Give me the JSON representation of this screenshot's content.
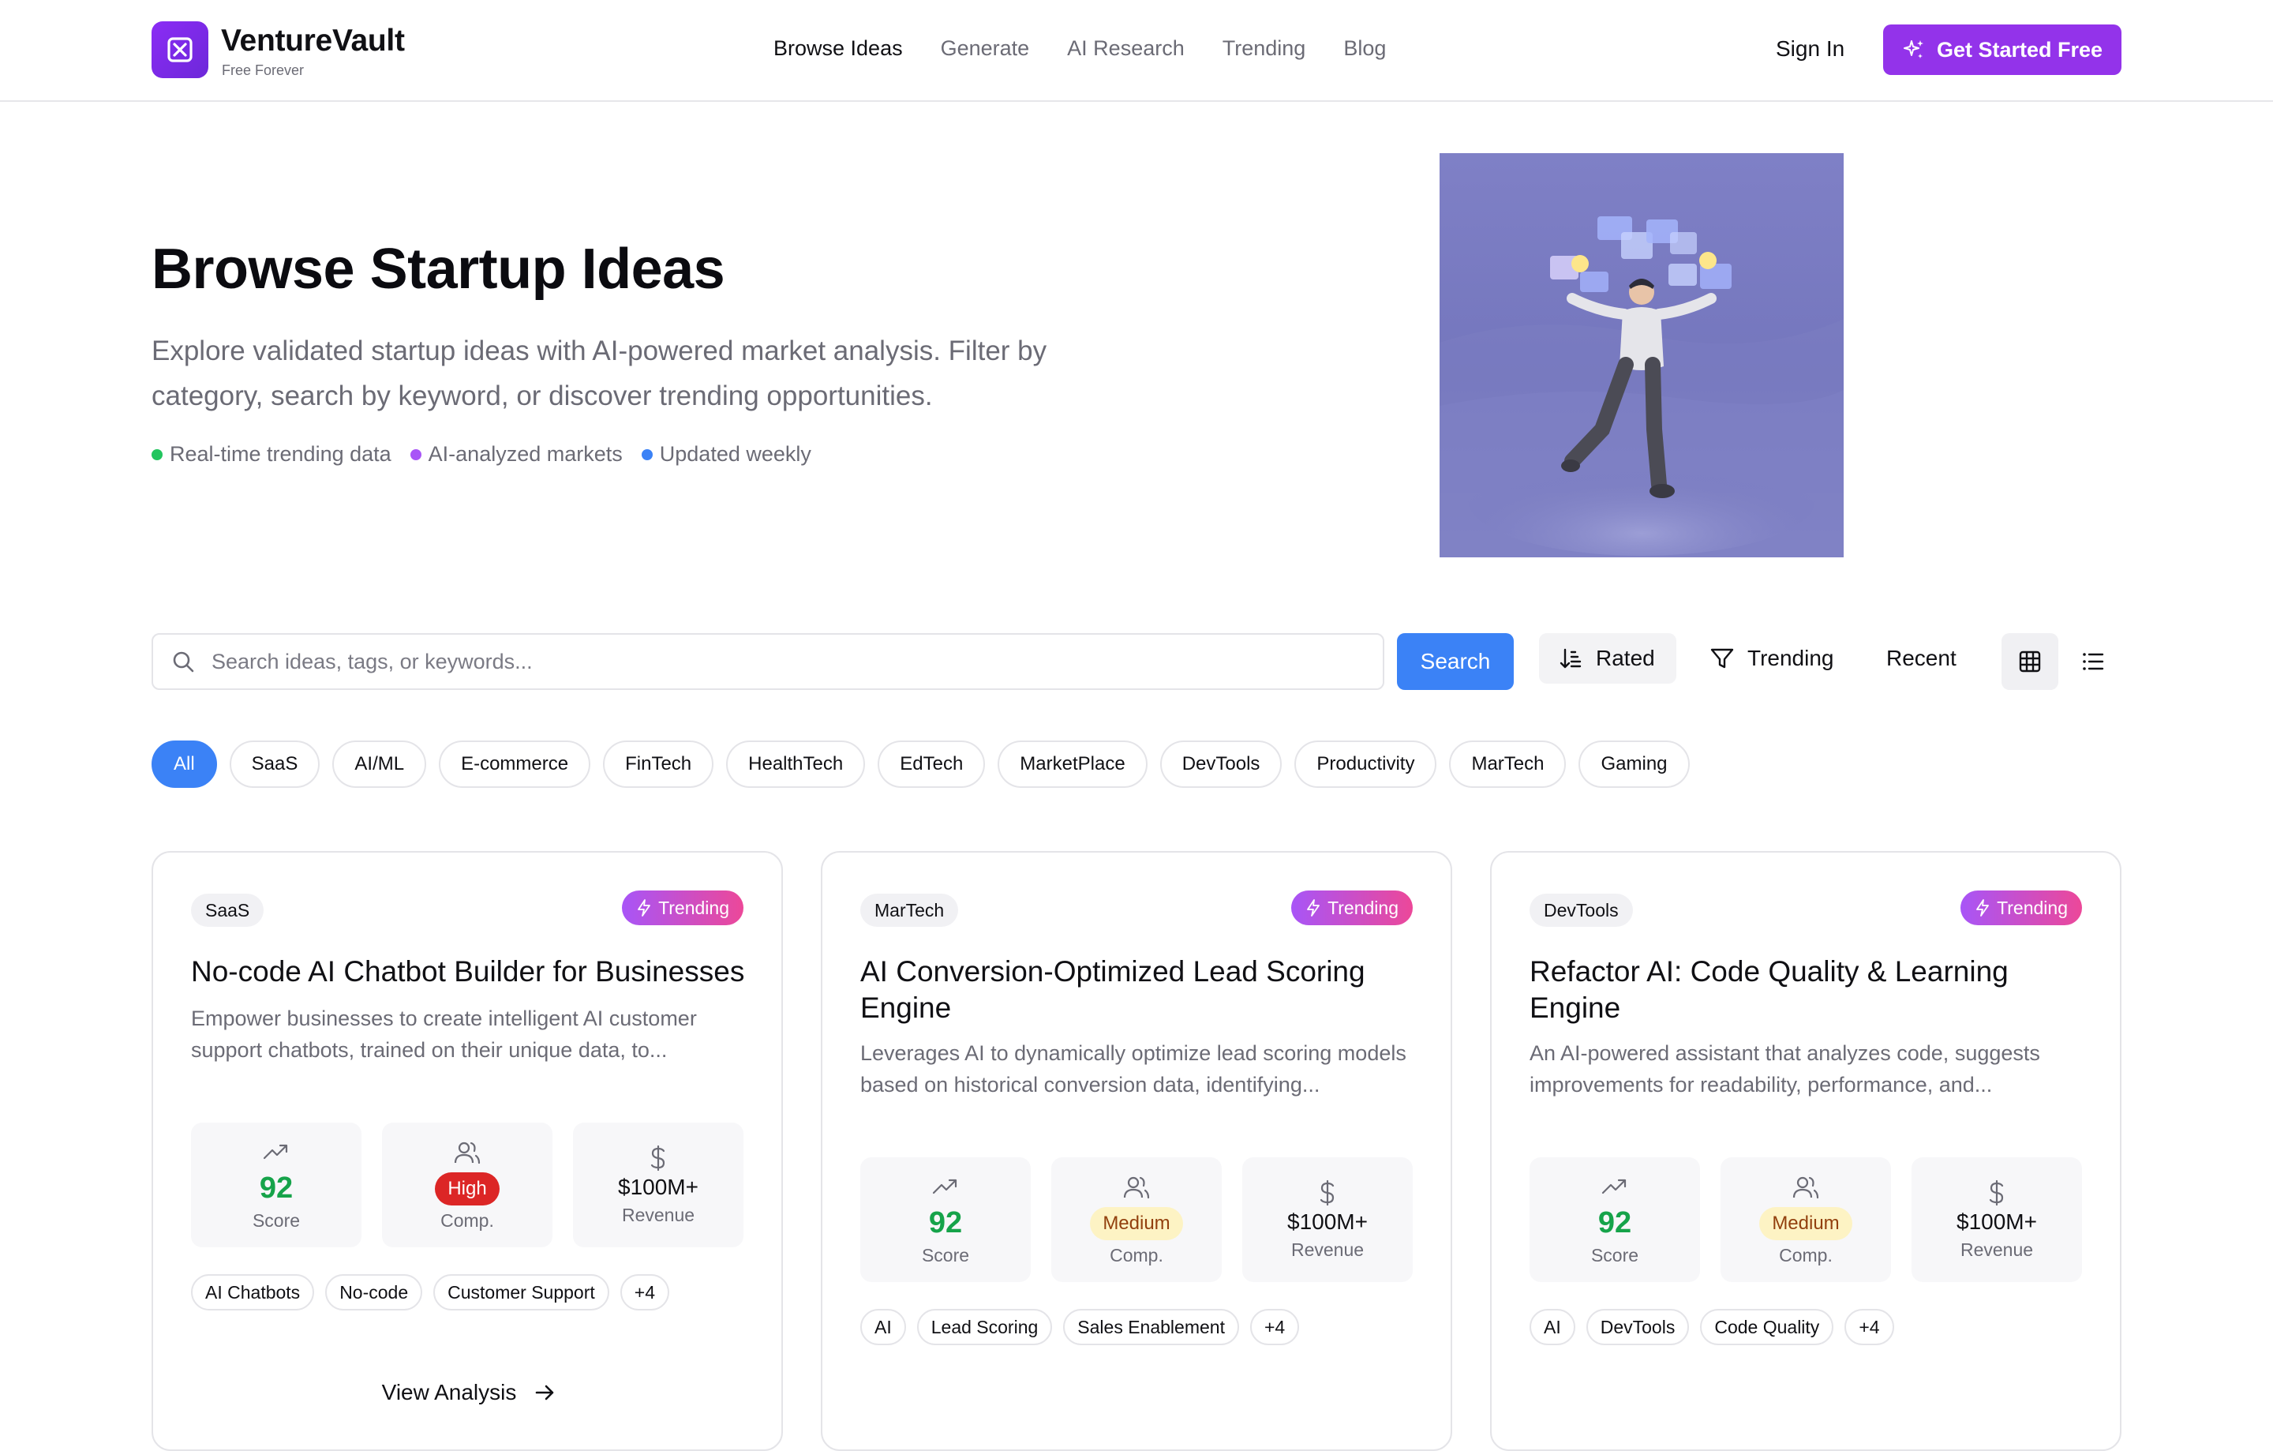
{
  "brand": {
    "name": "VentureVault",
    "tagline": "Free Forever"
  },
  "nav": [
    {
      "label": "Browse Ideas",
      "active": true
    },
    {
      "label": "Generate",
      "active": false
    },
    {
      "label": "AI Research",
      "active": false
    },
    {
      "label": "Trending",
      "active": false
    },
    {
      "label": "Blog",
      "active": false
    }
  ],
  "header": {
    "signin": "Sign In",
    "cta": "Get Started Free"
  },
  "hero": {
    "title": "Browse Startup Ideas",
    "description": "Explore validated startup ideas with AI-powered market analysis. Filter by category, search by keyword, or discover trending opportunities.",
    "bullets": [
      {
        "label": "Real-time trending data",
        "color": "#22c55e"
      },
      {
        "label": "AI-analyzed markets",
        "color": "#a855f7"
      },
      {
        "label": "Updated weekly",
        "color": "#3b82f6"
      }
    ]
  },
  "search": {
    "placeholder": "Search ideas, tags, or keywords...",
    "button": "Search"
  },
  "sort": {
    "rated": "Rated",
    "trending": "Trending",
    "recent": "Recent"
  },
  "categories": [
    "All",
    "SaaS",
    "AI/ML",
    "E-commerce",
    "FinTech",
    "HealthTech",
    "EdTech",
    "MarketPlace",
    "DevTools",
    "Productivity",
    "MarTech",
    "Gaming"
  ],
  "active_category": "All",
  "cards": [
    {
      "category": "SaaS",
      "badge": "Trending",
      "title": "No-code AI Chatbot Builder for Businesses",
      "description": "Empower businesses to create intelligent AI customer support chatbots, trained on their unique data, to...",
      "score": "92",
      "score_label": "Score",
      "competition": "High",
      "competition_label": "Comp.",
      "revenue": "$100M+",
      "revenue_label": "Revenue",
      "tags": [
        "AI Chatbots",
        "No-code",
        "Customer Support",
        "+4"
      ],
      "action": "View Analysis"
    },
    {
      "category": "MarTech",
      "badge": "Trending",
      "title": "AI Conversion-Optimized Lead Scoring Engine",
      "description": "Leverages AI to dynamically optimize lead scoring models based on historical conversion data, identifying...",
      "score": "92",
      "score_label": "Score",
      "competition": "Medium",
      "competition_label": "Comp.",
      "revenue": "$100M+",
      "revenue_label": "Revenue",
      "tags": [
        "AI",
        "Lead Scoring",
        "Sales Enablement",
        "+4"
      ]
    },
    {
      "category": "DevTools",
      "badge": "Trending",
      "title": "Refactor AI: Code Quality & Learning Engine",
      "description": "An AI-powered assistant that analyzes code, suggests improvements for readability, performance, and...",
      "score": "92",
      "score_label": "Score",
      "competition": "Medium",
      "competition_label": "Comp.",
      "revenue": "$100M+",
      "revenue_label": "Revenue",
      "tags": [
        "AI",
        "DevTools",
        "Code Quality",
        "+4"
      ]
    }
  ],
  "icons": {
    "logo": "x-square-icon",
    "cta": "sparkles-icon",
    "search": "search-icon",
    "rated": "sort-ascending-icon",
    "trending": "filter-icon",
    "grid": "grid-icon",
    "list": "list-icon",
    "trend_badge": "lightning-icon",
    "score": "trending-up-icon",
    "competition": "users-icon",
    "revenue": "dollar-icon",
    "arrow": "arrow-right-icon"
  },
  "colors": {
    "accent": "#9333ea",
    "primary": "#3b82f6",
    "score": "#16a34a",
    "high": "#dc2626",
    "medium": "#fdf3c4"
  }
}
